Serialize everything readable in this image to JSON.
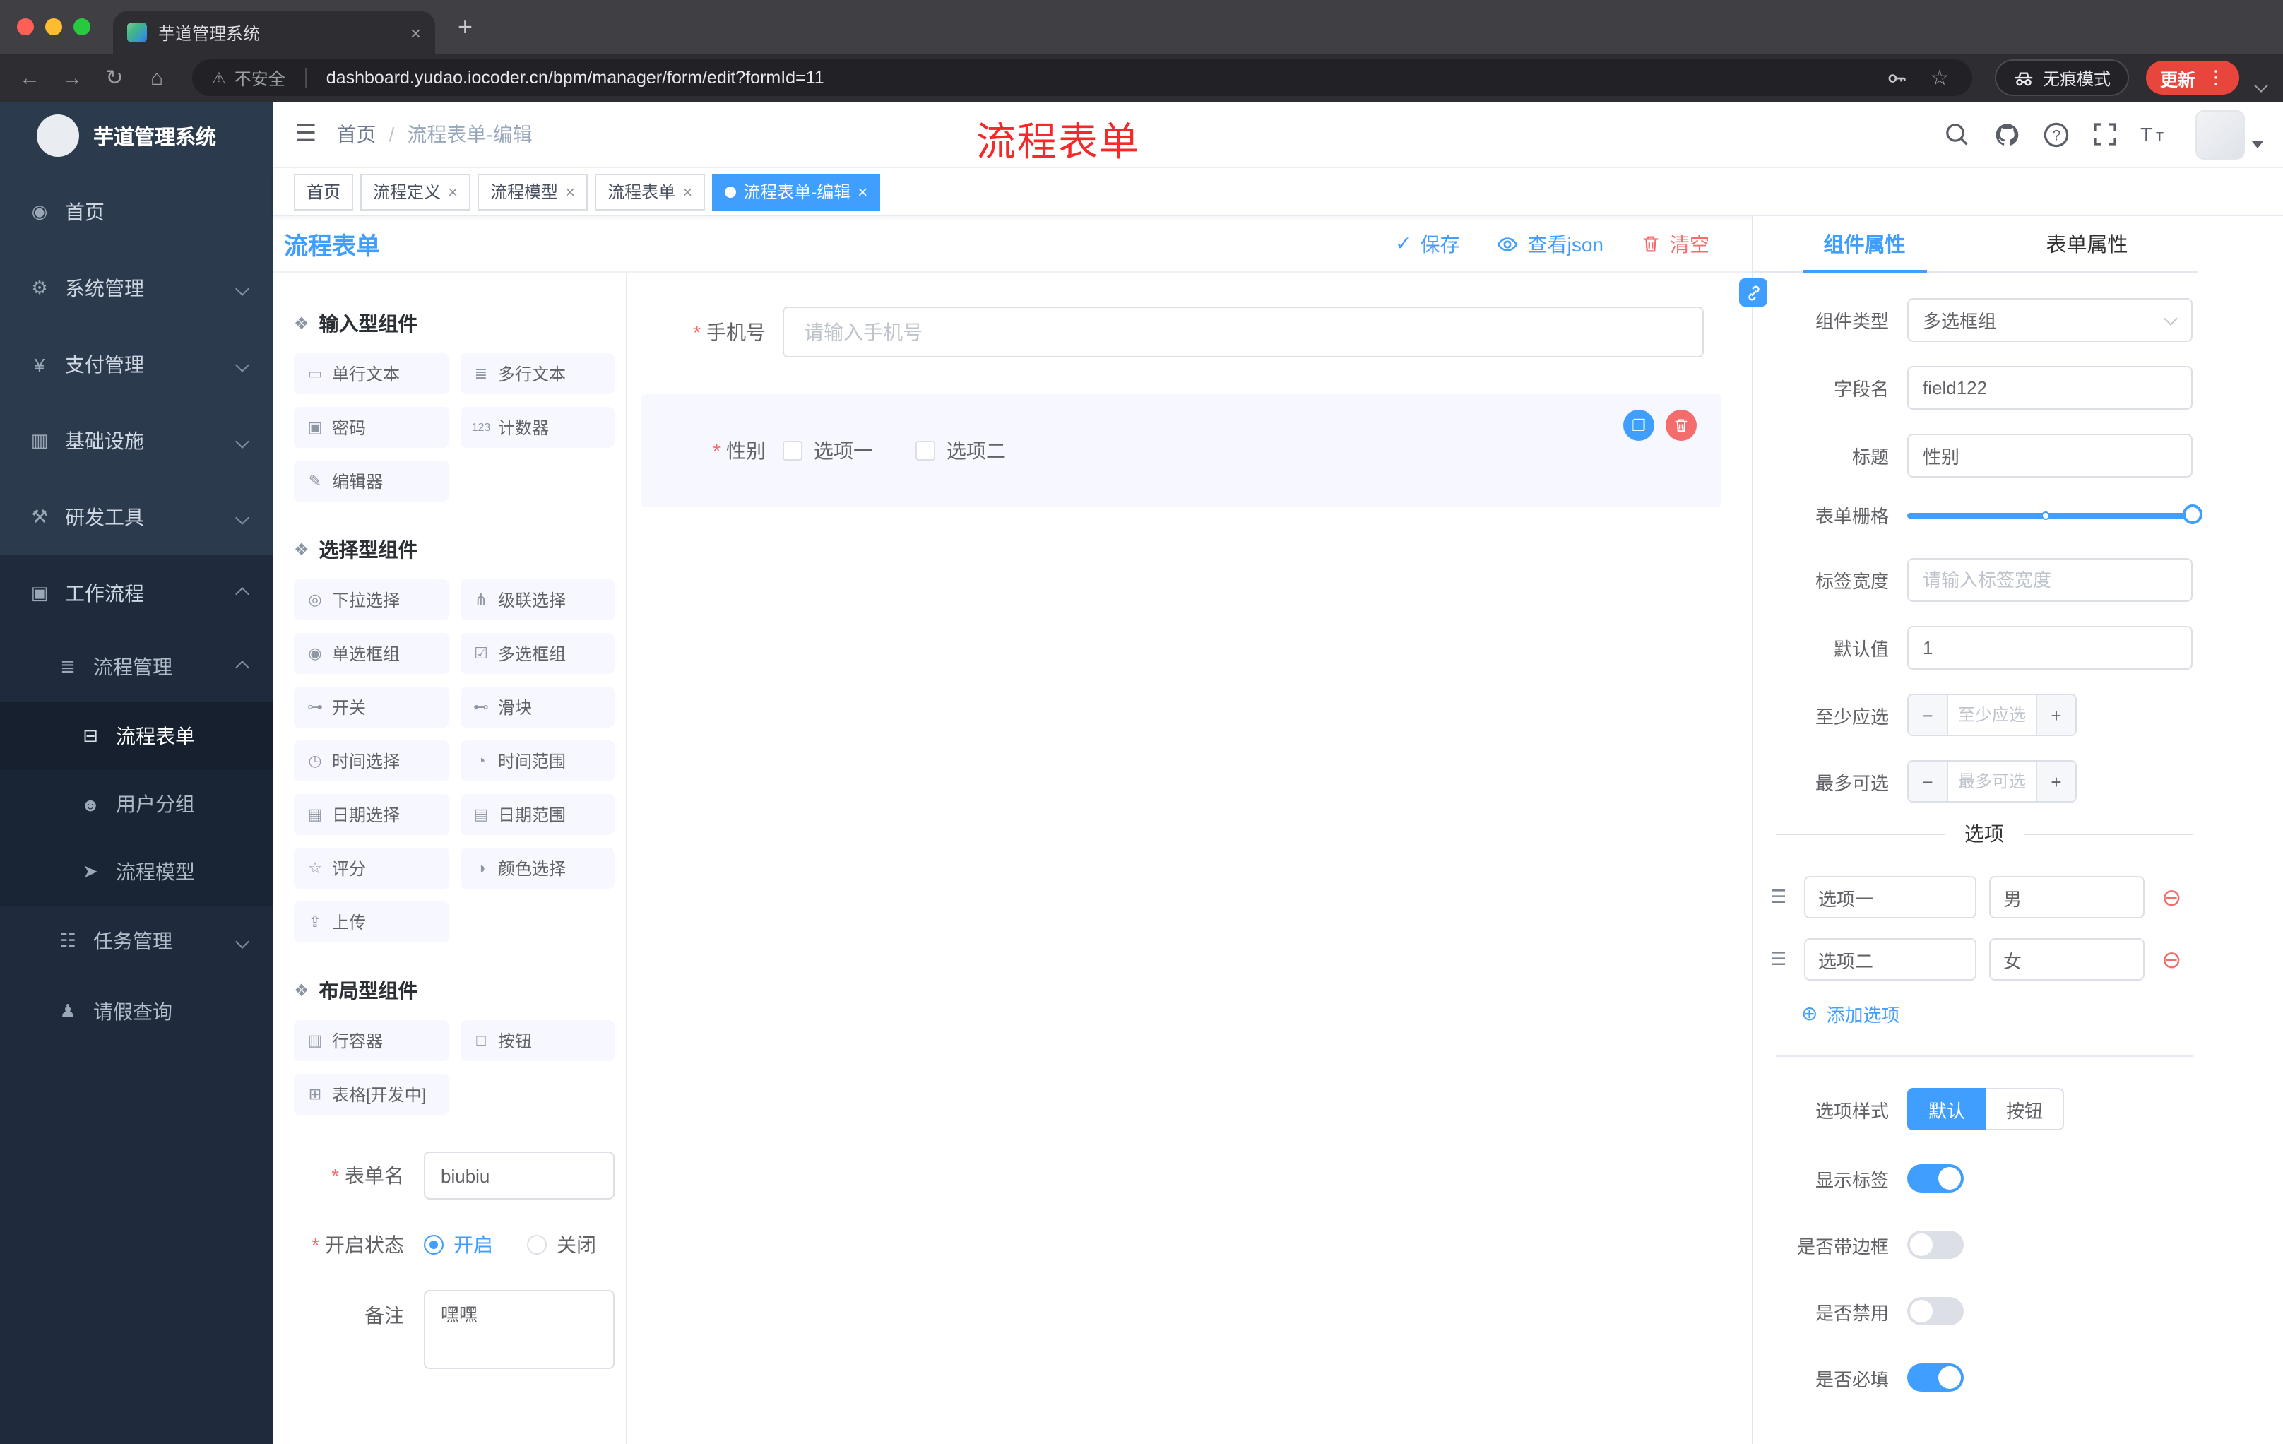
{
  "browser": {
    "tab_title": "芋道管理系统",
    "security_label": "不安全",
    "url": "dashboard.yudao.iocoder.cn/bpm/manager/form/edit?formId=11",
    "incognito_label": "无痕模式",
    "update_label": "更新"
  },
  "icons": {
    "section": "❖",
    "save_check": "✓",
    "copy": "❐",
    "drag_handle": "☰",
    "add_circle": "⊕",
    "remove_circle": "⊖",
    "warning": "⚠",
    "hamburger": "☰",
    "back": "←",
    "forward": "→",
    "reload": "↻",
    "home": "⌂",
    "star": "☆",
    "menu_dots": "⋮",
    "minus": "−",
    "plus": "+",
    "close": "×",
    "new_tab": "+"
  },
  "sidebar": {
    "logo_title": "芋道管理系统",
    "items": [
      {
        "label": "首页",
        "icon": "◉"
      },
      {
        "label": "系统管理",
        "icon": "⚙"
      },
      {
        "label": "支付管理",
        "icon": "¥"
      },
      {
        "label": "基础设施",
        "icon": "▥"
      },
      {
        "label": "研发工具",
        "icon": "⚒"
      },
      {
        "label": "工作流程",
        "icon": "▣"
      },
      {
        "label": "流程管理",
        "icon": "≣"
      },
      {
        "label": "流程表单",
        "icon": "⊟"
      },
      {
        "label": "用户分组",
        "icon": "☻"
      },
      {
        "label": "流程模型",
        "icon": "➤"
      },
      {
        "label": "任务管理",
        "icon": "☷"
      },
      {
        "label": "请假查询",
        "icon": "♟"
      }
    ]
  },
  "header": {
    "breadcrumb_home": "首页",
    "breadcrumb_current": "流程表单-编辑",
    "annotation": "流程表单"
  },
  "tags": [
    {
      "label": "首页"
    },
    {
      "label": "流程定义"
    },
    {
      "label": "流程模型"
    },
    {
      "label": "流程表单"
    },
    {
      "label": "流程表单-编辑"
    }
  ],
  "toolbar": {
    "title": "流程表单",
    "save": "保存",
    "view_json": "查看json",
    "clear": "清空"
  },
  "palette": {
    "sections": [
      {
        "title": "输入型组件",
        "items": [
          {
            "label": "单行文本",
            "icon": "▭"
          },
          {
            "label": "多行文本",
            "icon": "≣"
          },
          {
            "label": "密码",
            "icon": "▣"
          },
          {
            "label": "计数器",
            "icon": "123"
          },
          {
            "label": "编辑器",
            "icon": "✎"
          }
        ]
      },
      {
        "title": "选择型组件",
        "items": [
          {
            "label": "下拉选择",
            "icon": "◎"
          },
          {
            "label": "级联选择",
            "icon": "⋔"
          },
          {
            "label": "单选框组",
            "icon": "◉"
          },
          {
            "label": "多选框组",
            "icon": "☑"
          },
          {
            "label": "开关",
            "icon": "⊶"
          },
          {
            "label": "滑块",
            "icon": "⊷"
          },
          {
            "label": "时间选择",
            "icon": "◷"
          },
          {
            "label": "时间范围",
            "icon": "◔"
          },
          {
            "label": "日期选择",
            "icon": "▦"
          },
          {
            "label": "日期范围",
            "icon": "▤"
          },
          {
            "label": "评分",
            "icon": "☆"
          },
          {
            "label": "颜色选择",
            "icon": "◑"
          },
          {
            "label": "上传",
            "icon": "⇪"
          }
        ]
      },
      {
        "title": "布局型组件",
        "items": [
          {
            "label": "行容器",
            "icon": "▥"
          },
          {
            "label": "按钮",
            "icon": "□"
          },
          {
            "label": "表格[开发中]",
            "icon": "⊞"
          }
        ]
      }
    ]
  },
  "form_meta": {
    "name_label": "表单名",
    "name_value": "biubiu",
    "status_label": "开启状态",
    "status_on": "开启",
    "status_off": "关闭",
    "remark_label": "备注",
    "remark_value": "嘿嘿"
  },
  "canvas": {
    "phone_label": "手机号",
    "phone_placeholder": "请输入手机号",
    "gender_label": "性别",
    "gender_opt1": "选项一",
    "gender_opt2": "选项二"
  },
  "props": {
    "tab_component": "组件属性",
    "tab_form": "表单属性",
    "rows": {
      "type_label": "组件类型",
      "type_value": "多选框组",
      "field_label": "字段名",
      "field_value": "field122",
      "title_label": "标题",
      "title_value": "性别",
      "grid_label": "表单栅格",
      "width_label": "标签宽度",
      "width_placeholder": "请输入标签宽度",
      "default_label": "默认值",
      "default_value": "1",
      "min_label": "至少应选",
      "min_placeholder": "至少应选",
      "max_label": "最多可选",
      "max_placeholder": "最多可选"
    },
    "options_title": "选项",
    "options": [
      {
        "name": "选项一",
        "value": "男"
      },
      {
        "name": "选项二",
        "value": "女"
      }
    ],
    "add_option": "添加选项",
    "style_label": "选项样式",
    "style_default": "默认",
    "style_button": "按钮",
    "toggle_show_label": "显示标签",
    "toggle_border": "是否带边框",
    "toggle_disabled": "是否禁用",
    "toggle_required": "是否必填"
  },
  "colors": {
    "accent": "#409eff",
    "danger": "#f56c6c",
    "annotation_red": "#f42a2a",
    "palette_chip_bg": "#f6f7ff",
    "sidebar_bg": "#2c3a4e"
  }
}
